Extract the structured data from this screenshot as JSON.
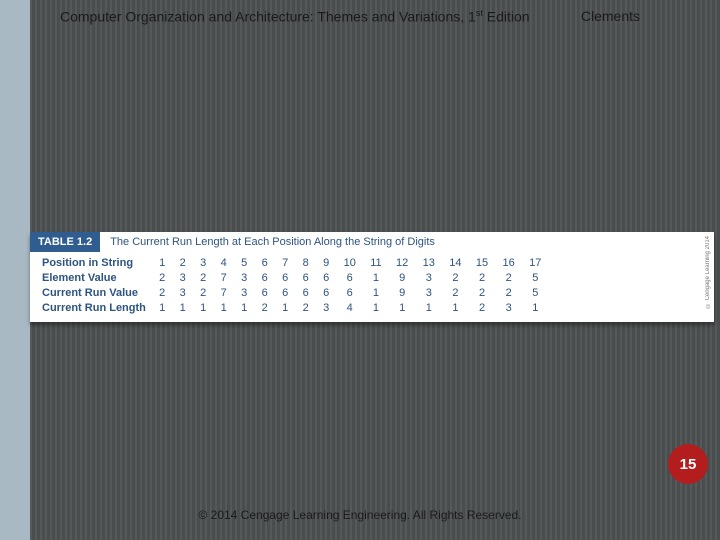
{
  "header": {
    "title_part1": "Computer Organization and Architecture: Themes and Variations, 1",
    "title_sup": "st",
    "title_part2": " Edition",
    "author": "Clements"
  },
  "table": {
    "tab_label": "TABLE 1.2",
    "title": "The Current Run Length at Each Position Along the String of Digits",
    "row_labels": [
      "Position in String",
      "Element Value",
      "Current Run Value",
      "Current Run Length"
    ],
    "attribution": "© Cengage Learning 2014"
  },
  "chart_data": {
    "type": "table",
    "title": "The Current Run Length at Each Position Along the String of Digits",
    "columns_count": 17,
    "rows": [
      {
        "name": "Position in String",
        "values": [
          1,
          2,
          3,
          4,
          5,
          6,
          7,
          8,
          9,
          10,
          11,
          12,
          13,
          14,
          15,
          16,
          17
        ]
      },
      {
        "name": "Element Value",
        "values": [
          2,
          3,
          2,
          7,
          3,
          6,
          6,
          6,
          6,
          6,
          1,
          9,
          3,
          2,
          2,
          2,
          5
        ]
      },
      {
        "name": "Current Run Value",
        "values": [
          2,
          3,
          2,
          7,
          3,
          6,
          6,
          6,
          6,
          6,
          1,
          9,
          3,
          2,
          2,
          2,
          5
        ]
      },
      {
        "name": "Current Run Length",
        "values": [
          1,
          1,
          1,
          1,
          1,
          2,
          1,
          2,
          3,
          4,
          1,
          1,
          1,
          1,
          2,
          3,
          1
        ]
      }
    ]
  },
  "footer": {
    "copyright": "© 2014 Cengage Learning Engineering. All Rights Reserved."
  },
  "page_number": "15"
}
